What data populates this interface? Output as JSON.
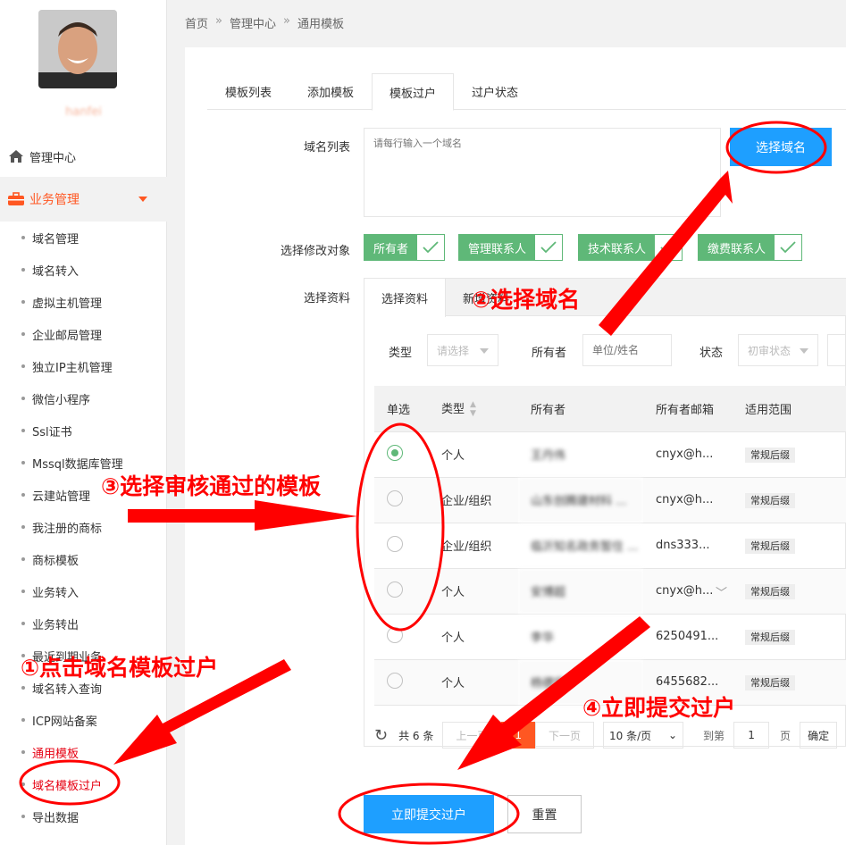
{
  "breadcrumb": [
    "首页",
    "管理中心",
    "通用模板"
  ],
  "breadcrumb_sep": "»",
  "sidebar": {
    "username": "hanfei",
    "top_item": "管理中心",
    "group": "业务管理",
    "items": [
      "域名管理",
      "域名转入",
      "虚拟主机管理",
      "企业邮局管理",
      "独立IP主机管理",
      "微信小程序",
      "Ssl证书",
      "Mssql数据库管理",
      "云建站管理",
      "我注册的商标",
      "商标模板",
      "业务转入",
      "业务转出",
      "最近到期业务",
      "域名转入查询",
      "ICP网站备案",
      "通用模板",
      "域名模板过户",
      "导出数据"
    ]
  },
  "tabs": [
    "模板列表",
    "添加模板",
    "模板过户",
    "过户状态"
  ],
  "form": {
    "domain_list_label": "域名列表",
    "domain_placeholder": "请每行输入一个域名",
    "select_domain_button": "选择域名",
    "modify_target_label": "选择修改对象",
    "targets": [
      "所有者",
      "管理联系人",
      "技术联系人",
      "缴费联系人"
    ],
    "select_profile_label": "选择资料",
    "submit_button": "立即提交过户",
    "reset_button": "重置"
  },
  "card": {
    "tabs": [
      "选择资料",
      "新增资料"
    ],
    "filters": {
      "type_label": "类型",
      "type_placeholder": "请选择",
      "owner_label": "所有者",
      "owner_placeholder": "单位/姓名",
      "status_label": "状态",
      "status_placeholder": "初审状态"
    }
  },
  "table": {
    "headers": [
      "单选",
      "类型",
      "所有者",
      "所有者邮箱",
      "适用范围"
    ],
    "rows": [
      {
        "type": "个人",
        "owner": "王丹伟",
        "email": "cnyx@h...",
        "scope": "常规后缀"
      },
      {
        "type": "企业/组织",
        "owner": "山东创腾建材科 ...",
        "email": "cnyx@h...",
        "scope": "常规后缀"
      },
      {
        "type": "企业/组织",
        "owner": "临沂知名政务暂住 ...",
        "email": "dns333...",
        "scope": "常规后缀"
      },
      {
        "type": "个人",
        "owner": "安博超",
        "email": "cnyx@h...",
        "scope": "常规后缀"
      },
      {
        "type": "个人",
        "owner": "李华",
        "email": "6250491...",
        "scope": "常规后缀"
      },
      {
        "type": "个人",
        "owner": "杨德宏",
        "email": "6455682...",
        "scope": "常规后缀"
      }
    ]
  },
  "pager": {
    "total": "共 6 条",
    "prev": "上一页",
    "current": "1",
    "next": "下一页",
    "per_page": "10 条/页",
    "goto": "到第",
    "page_value": "1",
    "page_unit": "页",
    "confirm": "确定"
  },
  "annotations": {
    "step1": "①点击域名模板过户",
    "step2": "②选择域名",
    "step3": "③选择审核通过的模板",
    "step4": "④立即提交过户"
  },
  "colors": {
    "accent_green": "#5fb878",
    "accent_blue": "#1e9fff",
    "accent_orange": "#ff5722",
    "annotation_red": "#ff0000"
  }
}
